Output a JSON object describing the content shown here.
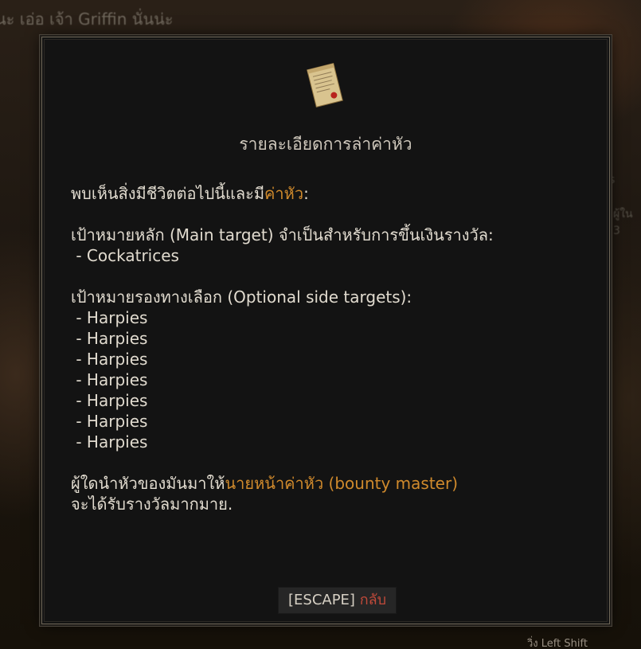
{
  "background": {
    "top_left_text": "นะ เอ่อ เจ้า Griffin นั่นน่ะ",
    "right_small_1": "s",
    "right_small_2": "ผู้ใน",
    "right_small_3": "3",
    "bottom_hint_key": "วิ่ง",
    "bottom_hint_label": "Left Shift"
  },
  "dialog": {
    "icon": "scroll-with-seal-icon",
    "title": "รายละเอียดการล่าค่าหัว",
    "intro_prefix": "พบเห็นสิ่งมีชีวิตต่อไปนี้และมี",
    "intro_highlight": "ค่าหัว",
    "intro_suffix": ":",
    "main_heading": "เป้าหมายหลัก (Main target) จำเป็นสำหรับการขึ้นเงินรางวัล:",
    "main_targets": [
      " - Cockatrices"
    ],
    "optional_heading": "เป้าหมายรองทางเลือก (Optional side targets):",
    "optional_targets": [
      " - Harpies",
      " - Harpies",
      " - Harpies",
      " - Harpies",
      " - Harpies",
      " - Harpies",
      " - Harpies"
    ],
    "outro_prefix": "ผู้ใดนำหัวของมันมาให้",
    "outro_highlight": "นายหน้าค่าหัว (bounty master)",
    "outro_line2": "จะได้รับรางวัลมากมาย.",
    "escape_key": "[ESCAPE]",
    "escape_action": "กลับ"
  },
  "colors": {
    "highlight": "#d08a2c",
    "escape_action": "#c24a3a",
    "panel": "#131313"
  }
}
